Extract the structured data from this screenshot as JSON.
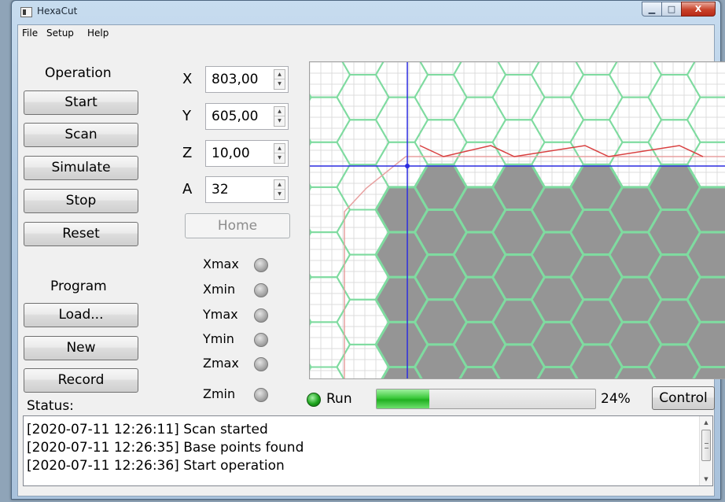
{
  "window": {
    "title": "HexaCut",
    "minimize_symbol": "▁",
    "maximize_symbol": "□",
    "close_symbol": "X"
  },
  "menu": [
    "File",
    "Setup",
    "Help"
  ],
  "operation": {
    "title": "Operation",
    "buttons": [
      "Start",
      "Scan",
      "Simulate",
      "Stop",
      "Reset"
    ]
  },
  "program": {
    "title": "Program",
    "buttons": [
      "Load...",
      "New",
      "Record"
    ]
  },
  "axes": [
    {
      "label": "X",
      "value": "803,00"
    },
    {
      "label": "Y",
      "value": "605,00"
    },
    {
      "label": "Z",
      "value": "10,00"
    },
    {
      "label": "A",
      "value": "32"
    }
  ],
  "spin_arrows": {
    "up": "▲",
    "down": "▼"
  },
  "home_label": "Home",
  "limits": [
    "Xmax",
    "Xmin",
    "Ymax",
    "Ymin",
    "Zmax",
    "Zmin"
  ],
  "status_label": "Status:",
  "run": {
    "label": "Run",
    "progress": 0.24,
    "percent_text": "24%"
  },
  "control_label": "Control",
  "log": [
    "[2020-07-11 12:26:11] Scan started",
    "[2020-07-11 12:26:35] Base points found",
    "[2020-07-11 12:26:36] Start operation"
  ],
  "log_scroll": {
    "up": "▲",
    "down": "▼"
  },
  "colors": {
    "led_active": "#22aa22",
    "progress": "#3bc93b",
    "hex_fill": "#959595",
    "hex_outline": "#7fdba0",
    "cut_path": "#e8a0a0",
    "crosshair": "#2c2ce0",
    "grid": "#dcdcdc"
  }
}
